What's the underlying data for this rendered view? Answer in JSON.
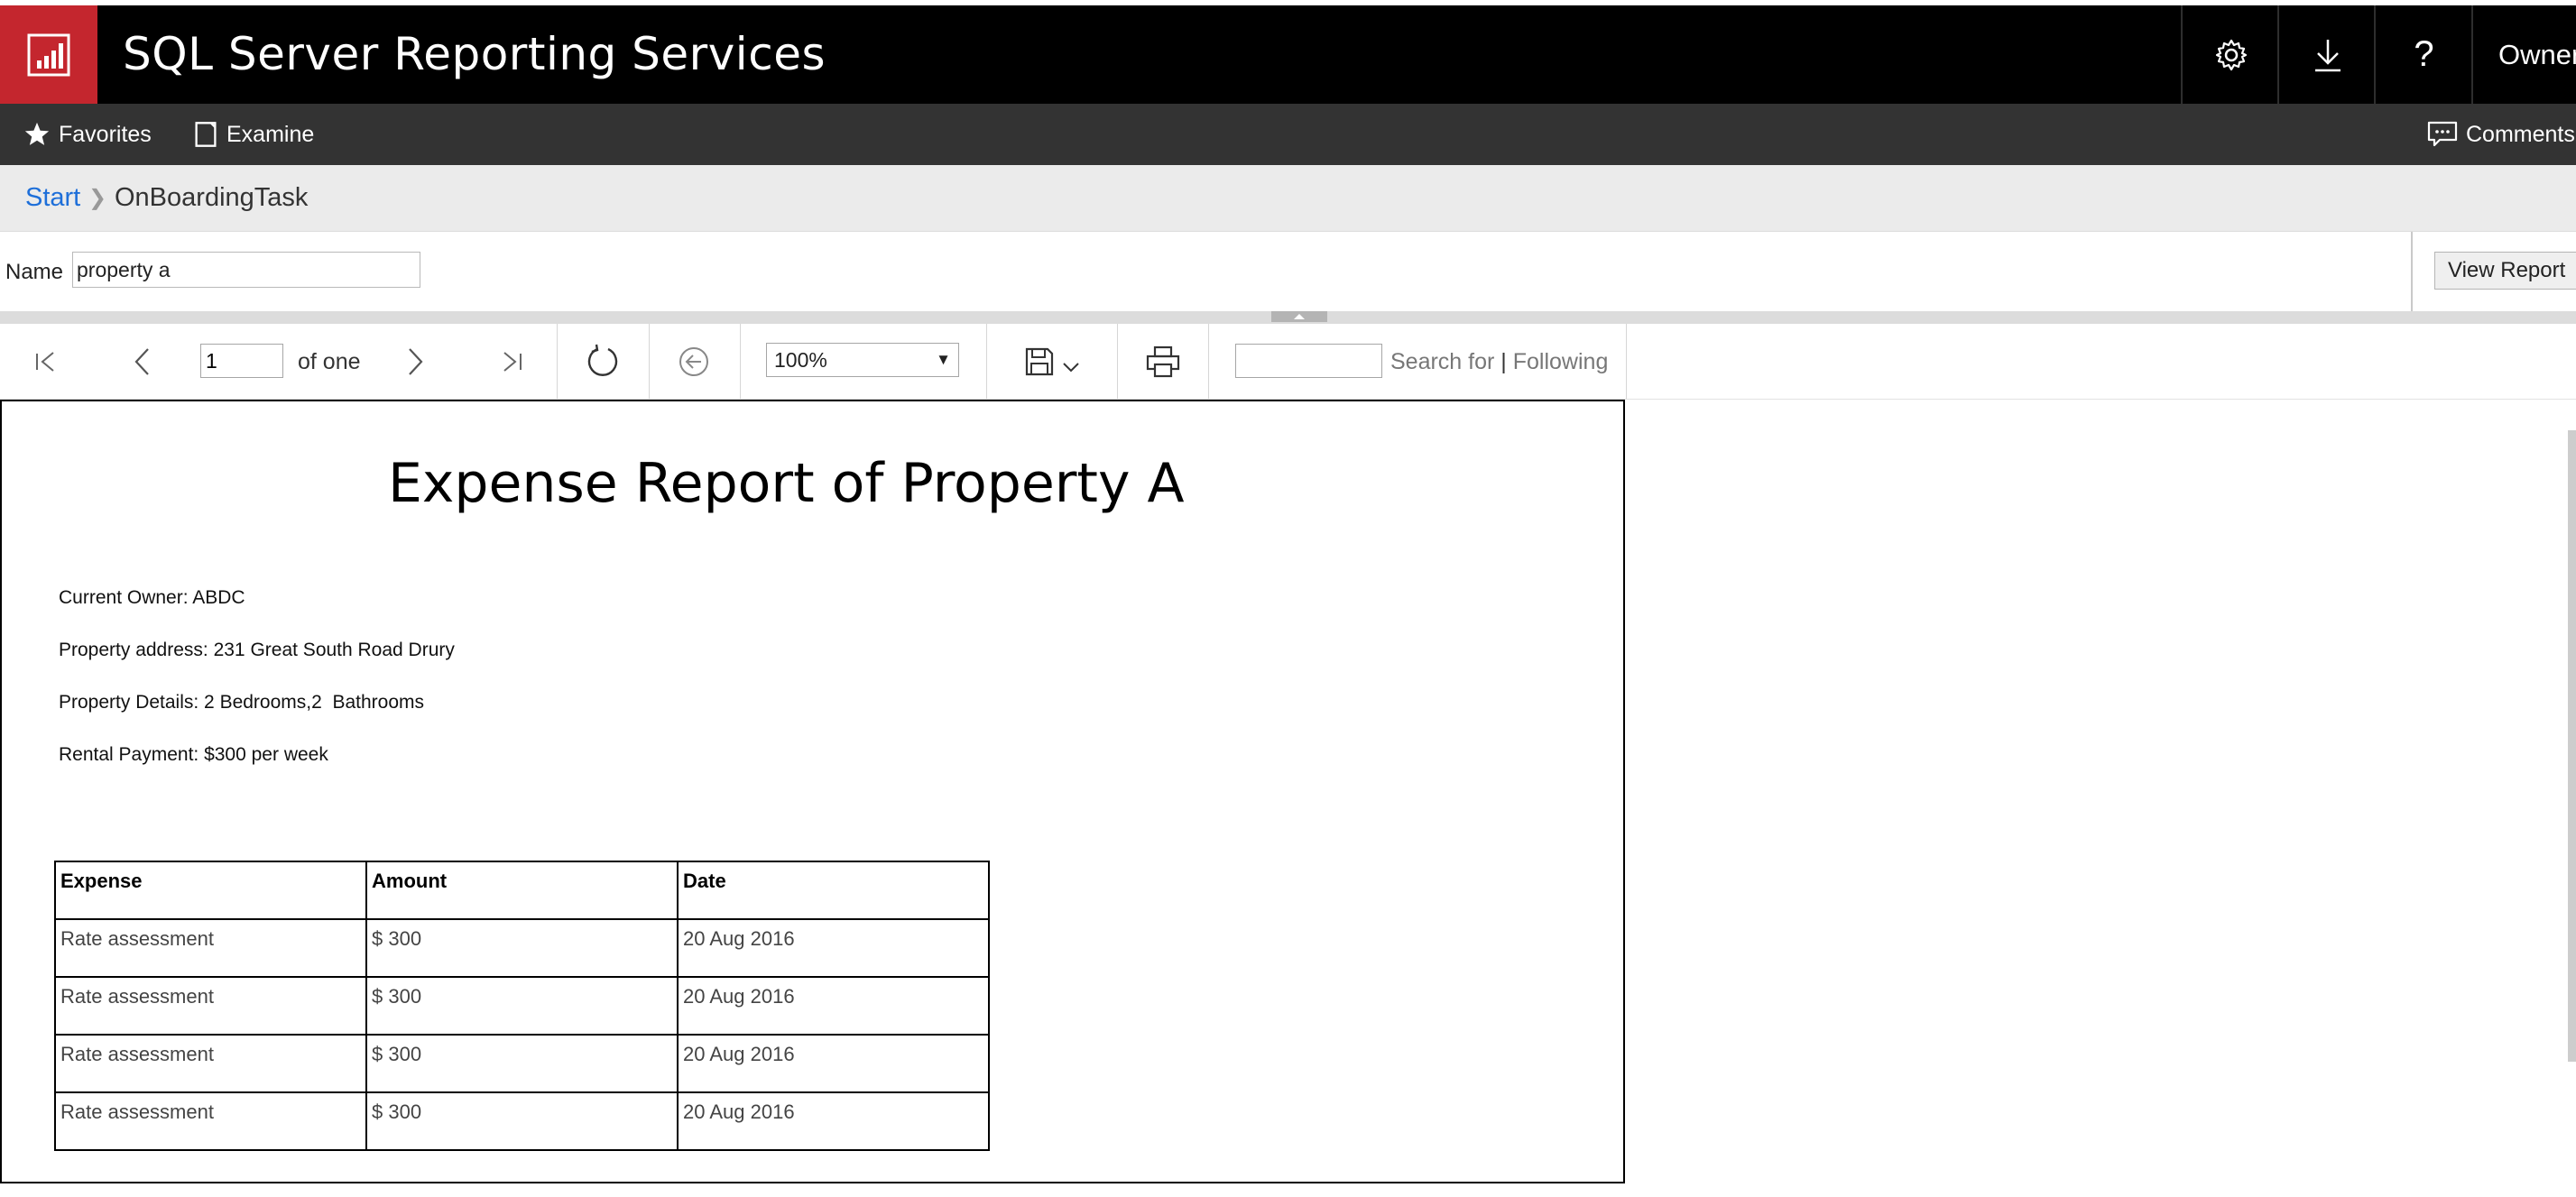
{
  "header": {
    "app_title": "SQL Server Reporting Services",
    "logo_icon": "report-bar-chart-icon",
    "brand_color": "#c4262e",
    "actions": [
      "settings-gear-icon",
      "download-icon",
      "help-question-icon"
    ],
    "user_label": "Owner"
  },
  "subnav": {
    "favorites_label": "Favorites",
    "examine_label": "Examine",
    "comments_label": "Comments"
  },
  "breadcrumb": {
    "start": "Start",
    "current": "OnBoardingTask"
  },
  "parameters": {
    "name_label": "Name",
    "name_value": "property a",
    "view_report_label": "View Report"
  },
  "toolbar": {
    "page_value": "1",
    "page_of": "of one",
    "zoom": "100%",
    "find_label": "Search for",
    "next_label": "Following"
  },
  "report": {
    "title": "Expense Report of Property A",
    "owner_line": "Current Owner: ABDC",
    "address_line": "Property address: 231 Great South Road Drury",
    "details_line": "Property Details: 2 Bedrooms,2  Bathrooms",
    "rent_line": "Rental Payment: $300 per week",
    "table": {
      "headers": [
        "Expense",
        "Amount",
        "Date"
      ],
      "rows": [
        [
          "Rate assessment",
          "$ 300",
          "20 Aug 2016"
        ],
        [
          "Rate assessment",
          "$ 300",
          "20 Aug 2016"
        ],
        [
          "Rate assessment",
          "$ 300",
          "20 Aug 2016"
        ],
        [
          "Rate assessment",
          "$ 300",
          "20 Aug 2016"
        ]
      ]
    }
  }
}
